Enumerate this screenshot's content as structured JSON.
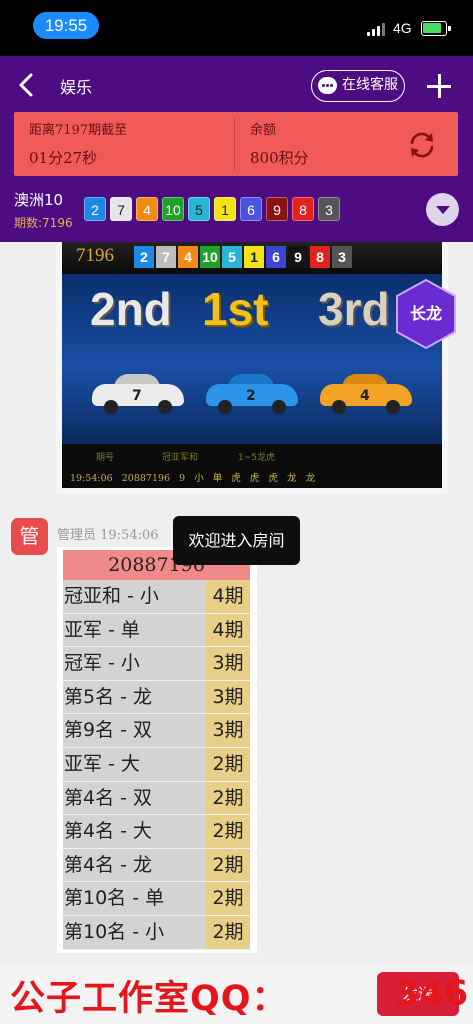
{
  "status_bar": {
    "time": "19:55",
    "network": "4G"
  },
  "header": {
    "title": "娱乐",
    "service_label": "在线客服"
  },
  "info": {
    "countdown_label": "距离7197期截至",
    "countdown_value": "01分27秒",
    "balance_label": "余额",
    "balance_value": "800积分"
  },
  "game": {
    "name": "澳洲10",
    "period_label": "期数:7196",
    "balls": [
      {
        "n": "2",
        "color": "#1e88e5"
      },
      {
        "n": "7",
        "color": "#e6e6e6"
      },
      {
        "n": "4",
        "color": "#f28a16"
      },
      {
        "n": "10",
        "color": "#1fa22b"
      },
      {
        "n": "5",
        "color": "#29b6d6"
      },
      {
        "n": "1",
        "color": "#f5e31a"
      },
      {
        "n": "6",
        "color": "#4a52e0"
      },
      {
        "n": "9",
        "color": "#8a1212"
      },
      {
        "n": "8",
        "color": "#e0231d"
      },
      {
        "n": "3",
        "color": "#555555"
      }
    ]
  },
  "banner": {
    "period": "7196",
    "balls": [
      {
        "n": "2",
        "color": "#1e88e5"
      },
      {
        "n": "7",
        "color": "#bdbdbd"
      },
      {
        "n": "4",
        "color": "#f28a16"
      },
      {
        "n": "10",
        "color": "#1fa22b"
      },
      {
        "n": "5",
        "color": "#29b6d6"
      },
      {
        "n": "1",
        "color": "#f5e31a"
      },
      {
        "n": "6",
        "color": "#3d44cf"
      },
      {
        "n": "9",
        "color": "#141414"
      },
      {
        "n": "8",
        "color": "#e0231d"
      },
      {
        "n": "3",
        "color": "#555555"
      }
    ],
    "rank_2nd": "2nd",
    "rank_1st": "1st",
    "rank_3rd": "3rd",
    "car_2nd": "7",
    "car_1st": "2",
    "car_3rd": "4",
    "col_period": "期号",
    "col_sum": "冠亚军和",
    "col_dragon": "1~5龙虎",
    "result_row": "19:54:06   20887196   9   小   单   虎   虎   虎   龙   龙",
    "dragon_badge": "长龙"
  },
  "message": {
    "avatar": "管",
    "sender": "管理员 19:54:06",
    "toast": "欢迎进入房间",
    "table_title": "20887196",
    "rows": [
      {
        "label": "冠亚和 - 小",
        "value": "4期"
      },
      {
        "label": "亚军 - 单",
        "value": "4期"
      },
      {
        "label": "冠军 - 小",
        "value": "3期"
      },
      {
        "label": "第5名 - 龙",
        "value": "3期"
      },
      {
        "label": "第9名 - 双",
        "value": "3期"
      },
      {
        "label": "亚军 - 大",
        "value": "2期"
      },
      {
        "label": "第4名 - 双",
        "value": "2期"
      },
      {
        "label": "第4名 - 大",
        "value": "2期"
      },
      {
        "label": "第4名 - 龙",
        "value": "2期"
      },
      {
        "label": "第10名 - 单",
        "value": "2期"
      },
      {
        "label": "第10名 - 小",
        "value": "2期"
      }
    ]
  },
  "bottom": {
    "watermark": "公子工作室QQ：",
    "send_label": "发送",
    "send_cover": "346"
  }
}
